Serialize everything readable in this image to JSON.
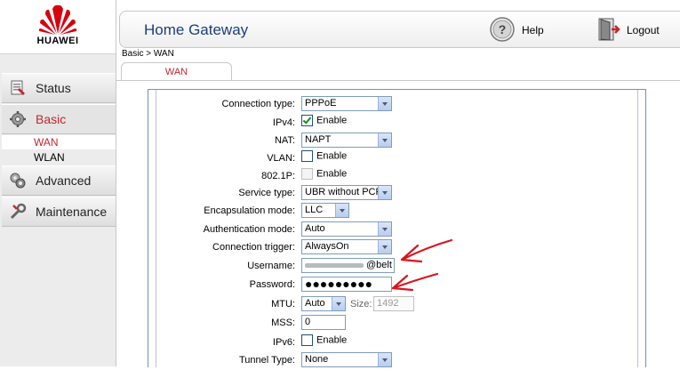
{
  "brand": "HUAWEI",
  "header": {
    "title": "Home Gateway",
    "help_label": "Help",
    "logout_label": "Logout"
  },
  "sidebar": {
    "items": [
      {
        "label": "Status",
        "icon": "status-icon"
      },
      {
        "label": "Basic",
        "icon": "basic-gear-icon"
      },
      {
        "label": "Advanced",
        "icon": "advanced-icon"
      },
      {
        "label": "Maintenance",
        "icon": "maintenance-icon"
      }
    ],
    "sub_items": [
      {
        "label": "WAN"
      },
      {
        "label": "WLAN"
      }
    ]
  },
  "breadcrumb": "Basic > WAN",
  "tab": {
    "label": "WAN"
  },
  "form": {
    "connection_type": {
      "label": "Connection type:",
      "value": "PPPoE"
    },
    "ipv4": {
      "label": "IPv4:",
      "checkbox_label": "Enable",
      "checked": true
    },
    "nat": {
      "label": "NAT:",
      "value": "NAPT"
    },
    "vlan": {
      "label": "VLAN:",
      "checkbox_label": "Enable",
      "checked": false
    },
    "dot1p": {
      "label": "802.1P:",
      "checkbox_label": "Enable",
      "checked": false
    },
    "service_type": {
      "label": "Service type:",
      "value": "UBR without PCR"
    },
    "encapsulation_mode": {
      "label": "Encapsulation mode:",
      "value": "LLC"
    },
    "authentication_mode": {
      "label": "Authentication mode:",
      "value": "Auto"
    },
    "connection_trigger": {
      "label": "Connection trigger:",
      "value": "AlwaysOn"
    },
    "username": {
      "label": "Username:",
      "value_suffix": "@belt"
    },
    "password": {
      "label": "Password:",
      "value": "●●●●●●●●●"
    },
    "mtu": {
      "label": "MTU:",
      "value": "Auto",
      "size_label": "Size:",
      "size_value": "1492"
    },
    "mss": {
      "label": "MSS:",
      "value": "0"
    },
    "ipv6": {
      "label": "IPv6:",
      "checkbox_label": "Enable",
      "checked": false
    },
    "tunnel_type": {
      "label": "Tunnel Type:",
      "value": "None"
    }
  },
  "colors": {
    "accent_red": "#c4262e",
    "title_blue": "#1d3f7a",
    "annotation_red": "#d8141e"
  }
}
